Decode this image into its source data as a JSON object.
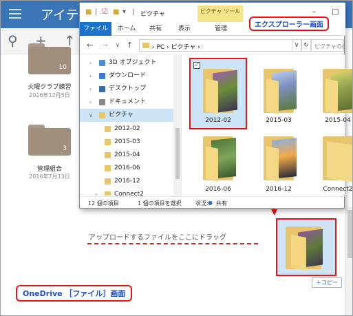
{
  "onedrive": {
    "app_title": "アイテ",
    "folders": [
      {
        "name": "火曜クラブ練習",
        "date": "2016年12月5日",
        "count": "10"
      },
      {
        "name": "管理組合",
        "date": "2016年7月13日",
        "count": "3"
      }
    ],
    "drop_hint": "アップロードするファイルをここにドラッグ",
    "label": "OneDrive ［ファイル］画面",
    "copy_badge": "＋コピー"
  },
  "explorer": {
    "title_path": "ピクチャ",
    "contextual_tab": "ピクチャ ツール",
    "ribbon_tabs": [
      "ファイル",
      "ホーム",
      "共有",
      "表示",
      "管理"
    ],
    "label": "エクスプローラー画面",
    "address": [
      "PC",
      "ピクチャ"
    ],
    "search_placeholder": "ピクチャの検索",
    "nav_items": [
      {
        "label": "3D オブジェクト",
        "color": "#4a8fd6"
      },
      {
        "label": "ダウンロード",
        "color": "#3a7bd5"
      },
      {
        "label": "デスクトップ",
        "color": "#2f6fb0"
      },
      {
        "label": "ドキュメント",
        "color": "#8a8a8a"
      },
      {
        "label": "ピクチャ",
        "color": "#e8c46a"
      },
      {
        "label": "2012-02",
        "color": "#e8c46a"
      },
      {
        "label": "2015-03",
        "color": "#e8c46a"
      },
      {
        "label": "2015-04",
        "color": "#e8c46a"
      },
      {
        "label": "2016-06",
        "color": "#e8c46a"
      },
      {
        "label": "2016-12",
        "color": "#e8c46a"
      },
      {
        "label": "Connect2",
        "color": "#e8c46a"
      }
    ],
    "folders": [
      "2012-02",
      "2015-03",
      "2015-04",
      "2016-06",
      "2016-12",
      "Connect2"
    ],
    "status": {
      "items": "12 個の項目",
      "selected": "1 個の項目を選択",
      "state_label": "状況:",
      "shared": "共有"
    }
  }
}
